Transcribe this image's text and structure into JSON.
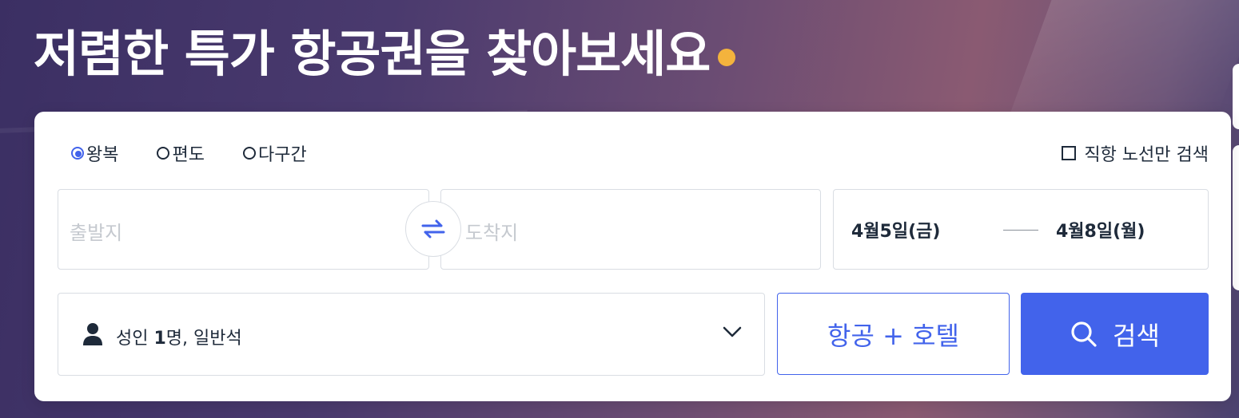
{
  "hero": {
    "title": "저렴한 특가 항공권을 찾아보세요"
  },
  "trip_types": [
    {
      "label": "왕복",
      "selected": true
    },
    {
      "label": "편도",
      "selected": false
    },
    {
      "label": "다구간",
      "selected": false
    }
  ],
  "direct_only": {
    "label": "직항 노선만 검색",
    "checked": false
  },
  "route": {
    "origin_placeholder": "출발지",
    "destination_placeholder": "도착지"
  },
  "dates": {
    "depart": "4월5일(금)",
    "return": "4월8일(월)"
  },
  "passengers": {
    "summary_prefix": "성인 ",
    "summary_count": "1",
    "summary_suffix": "명, 일반석"
  },
  "actions": {
    "air_hotel_label": "항공 + 호텔",
    "search_label": "검색"
  },
  "colors": {
    "accent": "#4263eb",
    "dot": "#f3b33d"
  }
}
